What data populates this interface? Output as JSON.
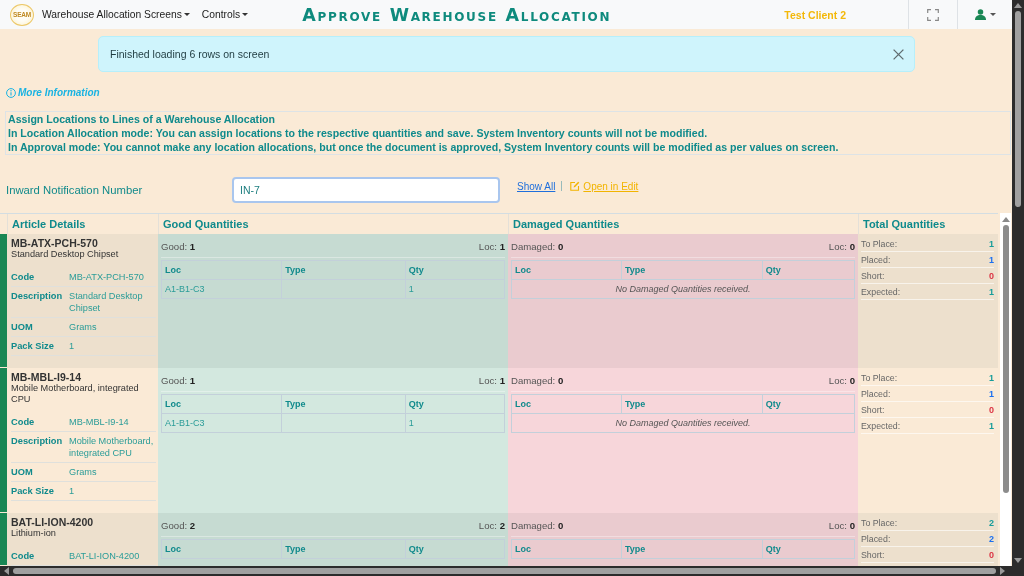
{
  "navbar": {
    "logo_text": "SEAM",
    "menus": [
      {
        "label": "Warehouse Allocation Screens"
      },
      {
        "label": "Controls"
      }
    ],
    "title": "Approve Warehouse Allocation",
    "client": "Test Client 2"
  },
  "alert": {
    "message": "Finished loading 6 rows on screen"
  },
  "more_info": {
    "label": "More Information"
  },
  "instructions": [
    "Assign Locations to Lines of a Warehouse Allocation",
    "In Location Allocation mode: You can assign locations to the respective quantities and save. System Inventory counts will not be modified.",
    "In Approval mode: You cannot make any location allocations, but once the document is approved, System Inventory counts will be modified as per values on screen."
  ],
  "search": {
    "label": "Inward Notification Number",
    "value": "IN-7",
    "links": [
      {
        "kind": "show_all",
        "label": "Show All"
      },
      {
        "kind": "edit",
        "label": "Open in Edit"
      }
    ]
  },
  "table": {
    "columns": [
      "Article Details",
      "Good Quantities",
      "Damaged Quantities",
      "Total Quantities"
    ],
    "rows": [
      {
        "code": "MB-ATX-PCH-570",
        "name": "Standard Desktop Chipset",
        "details": [
          {
            "label": "Code",
            "value": "MB-ATX-PCH-570"
          },
          {
            "label": "Description",
            "value": "Standard Desktop Chipset"
          },
          {
            "label": "UOM",
            "value": "Grams"
          },
          {
            "label": "Pack Size",
            "value": "1"
          }
        ],
        "good": {
          "label": "Good:",
          "count": "1",
          "loc_label": "Loc:",
          "loc_count": "1",
          "columns": [
            "Loc",
            "Type",
            "Qty"
          ],
          "lines": [
            {
              "loc": "A1-B1-C3",
              "qty": "1"
            }
          ]
        },
        "damaged": {
          "label": "Damaged:",
          "count": "0",
          "loc_label": "Loc:",
          "loc_count": "0",
          "columns": [
            "Loc",
            "Type",
            "Qty"
          ],
          "empty_message": "No Damaged Quantities received."
        },
        "totals": [
          {
            "kind": "to_place",
            "label": "To Place:",
            "value": "1"
          },
          {
            "kind": "placed",
            "label": "Placed:",
            "value": "1"
          },
          {
            "kind": "short",
            "label": "Short:",
            "value": "0"
          },
          {
            "kind": "expected",
            "label": "Expected:",
            "value": "1"
          }
        ]
      },
      {
        "code": "MB-MBL-I9-14",
        "name": "Mobile Motherboard, integrated CPU",
        "details": [
          {
            "label": "Code",
            "value": "MB-MBL-I9-14"
          },
          {
            "label": "Description",
            "value": "Mobile Motherboard, integrated CPU"
          },
          {
            "label": "UOM",
            "value": "Grams"
          },
          {
            "label": "Pack Size",
            "value": "1"
          }
        ],
        "good": {
          "label": "Good:",
          "count": "1",
          "loc_label": "Loc:",
          "loc_count": "1",
          "columns": [
            "Loc",
            "Type",
            "Qty"
          ],
          "lines": [
            {
              "loc": "A1-B1-C3",
              "qty": "1"
            }
          ]
        },
        "damaged": {
          "label": "Damaged:",
          "count": "0",
          "loc_label": "Loc:",
          "loc_count": "0",
          "columns": [
            "Loc",
            "Type",
            "Qty"
          ],
          "empty_message": "No Damaged Quantities received."
        },
        "totals": [
          {
            "kind": "to_place",
            "label": "To Place:",
            "value": "1"
          },
          {
            "kind": "placed",
            "label": "Placed:",
            "value": "1"
          },
          {
            "kind": "short",
            "label": "Short:",
            "value": "0"
          },
          {
            "kind": "expected",
            "label": "Expected:",
            "value": "1"
          }
        ]
      },
      {
        "code": "BAT-LI-ION-4200",
        "name": "Lithium-ion",
        "details": [
          {
            "label": "Code",
            "value": "BAT-LI-ION-4200"
          }
        ],
        "good": {
          "label": "Good:",
          "count": "2",
          "loc_label": "Loc:",
          "loc_count": "2",
          "columns": [
            "Loc",
            "Type",
            "Qty"
          ]
        },
        "damaged": {
          "label": "Damaged:",
          "count": "0",
          "loc_label": "Loc:",
          "loc_count": "0",
          "columns": [
            "Loc",
            "Type",
            "Qty"
          ]
        },
        "totals": [
          {
            "kind": "to_place",
            "label": "To Place:",
            "value": "2"
          },
          {
            "kind": "placed",
            "label": "Placed:",
            "value": "2"
          },
          {
            "kind": "short",
            "label": "Short:",
            "value": "0"
          }
        ]
      }
    ]
  }
}
